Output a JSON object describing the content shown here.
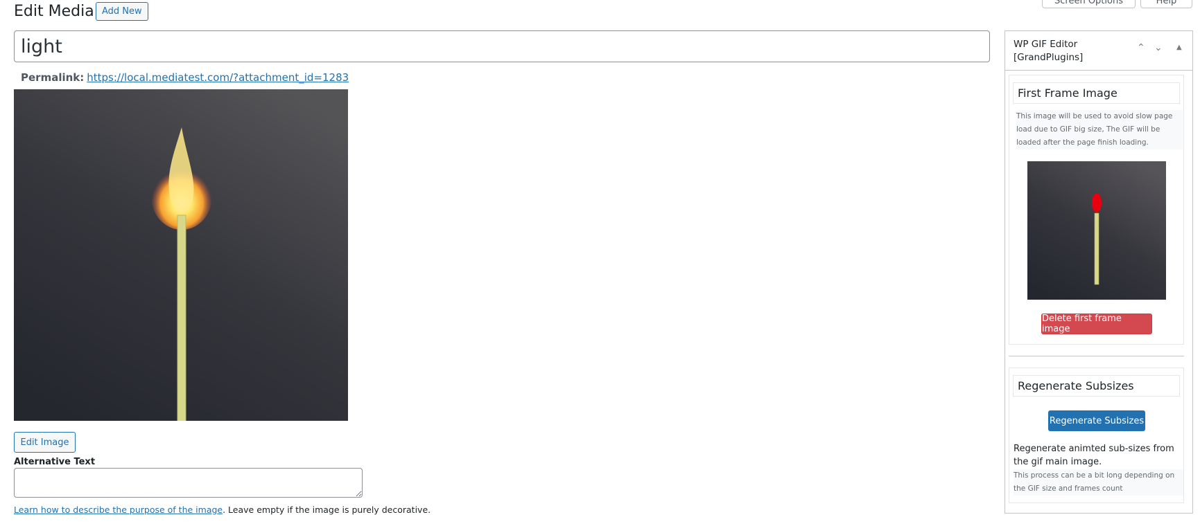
{
  "header": {
    "screen_options": "Screen Options",
    "help": "Help",
    "title": "Edit Media",
    "add_new": "Add New"
  },
  "post": {
    "title": "light",
    "permalink_label": "Permalink:",
    "permalink_url": "https://local.mediatest.com/?attachment_id=1283"
  },
  "media": {
    "edit_image": "Edit Image",
    "alt_label": "Alternative Text",
    "alt_value": "",
    "learn_link": "Learn how to describe the purpose of the image",
    "learn_suffix": ". Leave empty if the image is purely decorative."
  },
  "sidebar": {
    "title_line1": "WP GIF Editor",
    "title_line2": "[GrandPlugins]",
    "first_frame": {
      "title": "First Frame Image",
      "desc": "This image will be used to avoid slow page load due to GIF big size, The GIF will be loaded after the page finish loading.",
      "delete": "Delete first frame image"
    },
    "regen": {
      "title": "Regenerate Subsizes",
      "button": "Regenerate Subsizes",
      "desc": "Regenerate animted sub-sizes from the gif main image.",
      "note": "This process can be a bit long depending on the GIF size and frames count"
    }
  },
  "colors": {
    "primary": "#2271b1",
    "danger": "#d44950"
  }
}
